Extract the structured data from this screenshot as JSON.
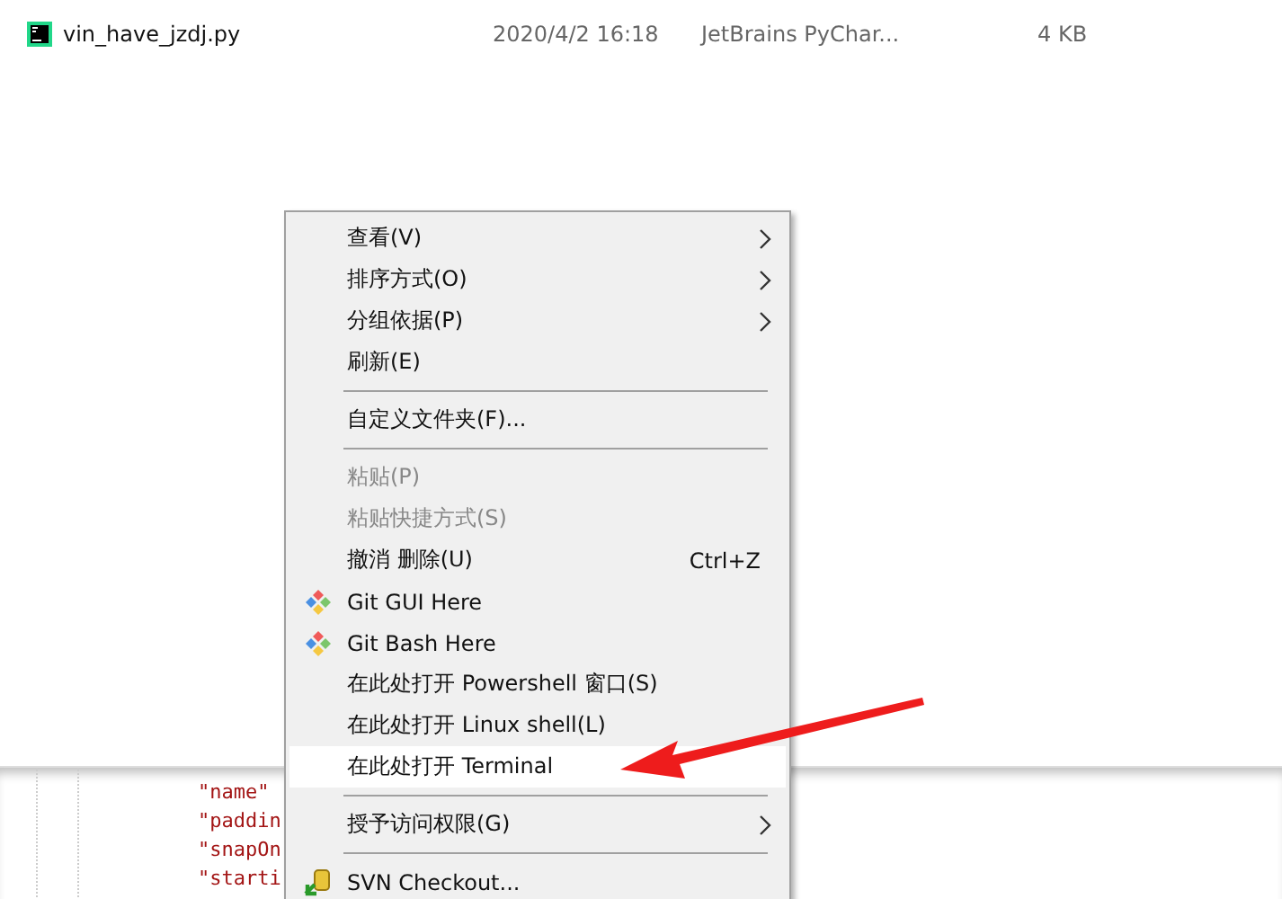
{
  "files": [
    {
      "name": "vin_have_jzdj.py",
      "date": "2020/4/2 16:18",
      "type": "JetBrains PyChar...",
      "size": "4 KB"
    }
  ],
  "code_lines": [
    "\"name\"",
    "\"paddin",
    "\"snapOn",
    "\"starti"
  ],
  "context_menu": [
    {
      "kind": "item",
      "label": "查看(V)",
      "submenu": true,
      "disabled": false,
      "selected": false
    },
    {
      "kind": "item",
      "label": "排序方式(O)",
      "submenu": true,
      "disabled": false,
      "selected": false
    },
    {
      "kind": "item",
      "label": "分组依据(P)",
      "submenu": true,
      "disabled": false,
      "selected": false
    },
    {
      "kind": "item",
      "label": "刷新(E)",
      "submenu": false,
      "disabled": false,
      "selected": false
    },
    {
      "kind": "separator"
    },
    {
      "kind": "item",
      "label": "自定义文件夹(F)...",
      "submenu": false,
      "disabled": false,
      "selected": false
    },
    {
      "kind": "separator"
    },
    {
      "kind": "item",
      "label": "粘贴(P)",
      "submenu": false,
      "disabled": true,
      "selected": false
    },
    {
      "kind": "item",
      "label": "粘贴快捷方式(S)",
      "submenu": false,
      "disabled": true,
      "selected": false
    },
    {
      "kind": "item",
      "label": "撤消 删除(U)",
      "shortcut": "Ctrl+Z",
      "submenu": false,
      "disabled": false,
      "selected": false
    },
    {
      "kind": "git",
      "label": "Git GUI Here",
      "submenu": false,
      "disabled": false,
      "selected": false
    },
    {
      "kind": "git",
      "label": "Git Bash Here",
      "submenu": false,
      "disabled": false,
      "selected": false
    },
    {
      "kind": "item",
      "label": "在此处打开 Powershell 窗口(S)",
      "submenu": false,
      "disabled": false,
      "selected": false
    },
    {
      "kind": "item",
      "label": "在此处打开 Linux shell(L)",
      "submenu": false,
      "disabled": false,
      "selected": false
    },
    {
      "kind": "item",
      "label": "在此处打开 Terminal",
      "submenu": false,
      "disabled": false,
      "selected": true
    },
    {
      "kind": "separator"
    },
    {
      "kind": "item",
      "label": "授予访问权限(G)",
      "submenu": true,
      "disabled": false,
      "selected": false
    },
    {
      "kind": "separator"
    },
    {
      "kind": "svn",
      "label": "SVN Checkout...",
      "submenu": false,
      "disabled": false,
      "selected": false
    }
  ]
}
